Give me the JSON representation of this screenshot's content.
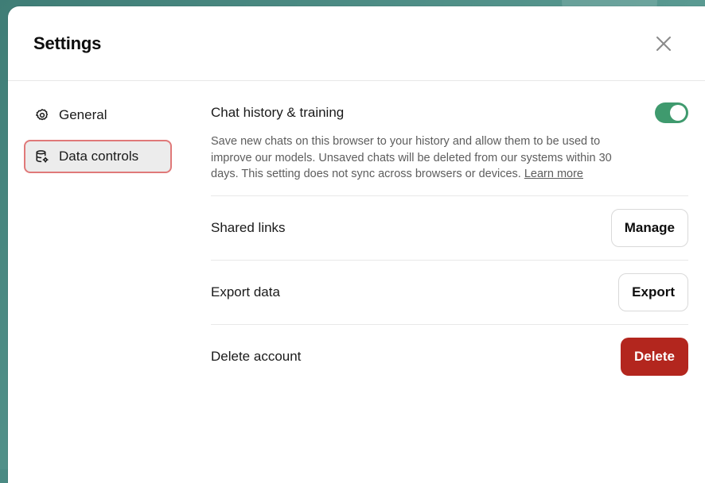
{
  "dialog": {
    "title": "Settings"
  },
  "sidebar": {
    "items": [
      {
        "label": "General",
        "icon": "gear-icon",
        "active": false
      },
      {
        "label": "Data controls",
        "icon": "database-gear-icon",
        "active": true
      }
    ]
  },
  "data_controls": {
    "chat_history": {
      "label": "Chat history & training",
      "description": "Save new chats on this browser to your history and allow them to be used to improve our models. Unsaved chats will be deleted from our systems within 30 days. This setting does not sync across browsers or devices.",
      "learn_more": "Learn more",
      "enabled": true
    },
    "shared_links": {
      "label": "Shared links",
      "button": "Manage"
    },
    "export_data": {
      "label": "Export data",
      "button": "Export"
    },
    "delete_account": {
      "label": "Delete account",
      "button": "Delete"
    }
  },
  "colors": {
    "toggle_on": "#3f9a6e",
    "danger": "#b3261e",
    "active_outline": "#e07979",
    "backdrop": "#4a8a83"
  }
}
